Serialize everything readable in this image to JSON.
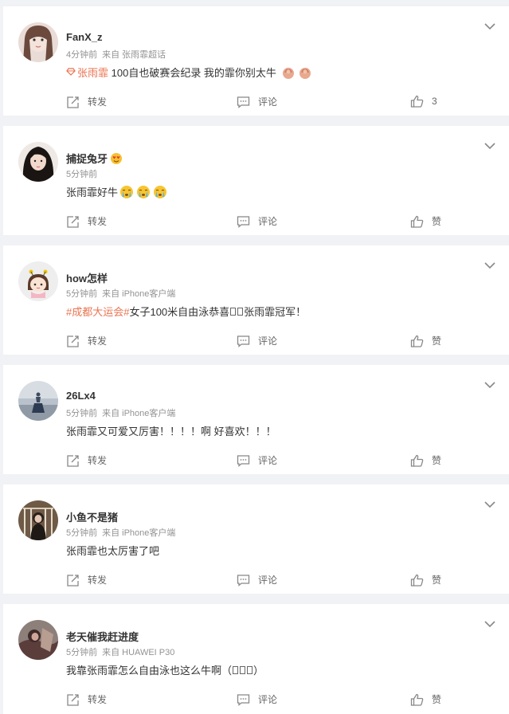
{
  "labels": {
    "repost": "转发",
    "comment": "评论",
    "like": "赞",
    "source_prefix": "来自"
  },
  "colors": {
    "topic": "#eb7350",
    "meta": "#939393",
    "background": "#f1f2f5"
  },
  "comments": [
    {
      "username": "FanX_z",
      "time": "4分钟前",
      "source": "张雨霏超话",
      "supertopic_tag": "张雨霏",
      "text": " 100自也破赛会纪录 我的霏你别太牛",
      "emojis": [
        "strong-arm-emoji",
        "strong-arm-emoji"
      ],
      "like_count": "3"
    },
    {
      "username": "捕捉兔牙",
      "badge": "heart-eyes-emoji",
      "time": "5分钟前",
      "text": "张雨霏好牛",
      "emojis": [
        "crying-emoji",
        "crying-emoji",
        "crying-emoji"
      ]
    },
    {
      "username": "how怎样",
      "time": "5分钟前",
      "source": "iPhone客户端",
      "hashtag": "#成都大运会#",
      "text_after": "女子100米自由泳恭喜",
      "text_end": "张雨霏冠军！"
    },
    {
      "username": "26Lx4",
      "time": "5分钟前",
      "source": "iPhone客户端",
      "text": "张雨霏又可爱又厉害！！！！啊 好喜欢！！！"
    },
    {
      "username": "小鱼不是猪",
      "time": "5分钟前",
      "source": "iPhone客户端",
      "text": "张雨霏也太厉害了吧"
    },
    {
      "username": "老天催我赶进度",
      "time": "5分钟前",
      "source": "HUAWEI P30",
      "text": "我靠张雨霏怎么自由泳也这么牛啊（",
      "text_end": "）"
    }
  ]
}
